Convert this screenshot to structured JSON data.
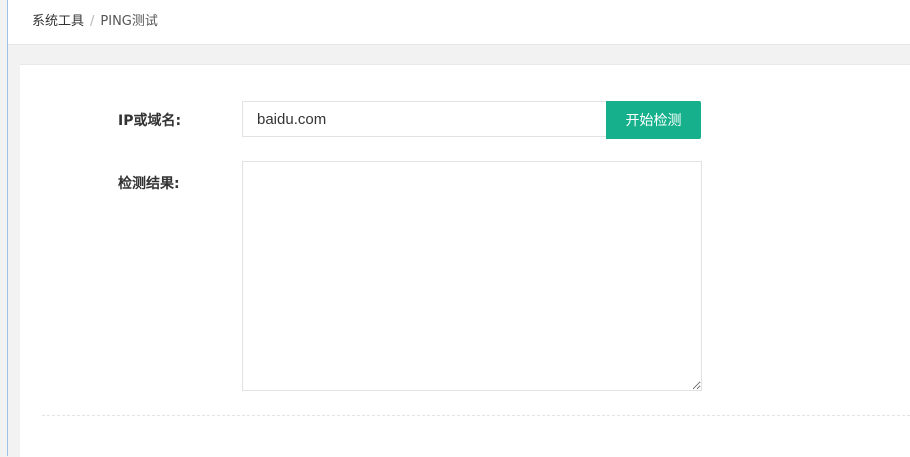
{
  "breadcrumb": {
    "parent": "系统工具",
    "separator": "/",
    "current": "PING测试"
  },
  "form": {
    "ip_label": "IP或域名:",
    "ip_value": "baidu.com",
    "start_button": "开始检测",
    "result_label": "检测结果:",
    "result_value": ""
  },
  "colors": {
    "accent": "#16b18c",
    "page_background": "#f2f2f2"
  }
}
